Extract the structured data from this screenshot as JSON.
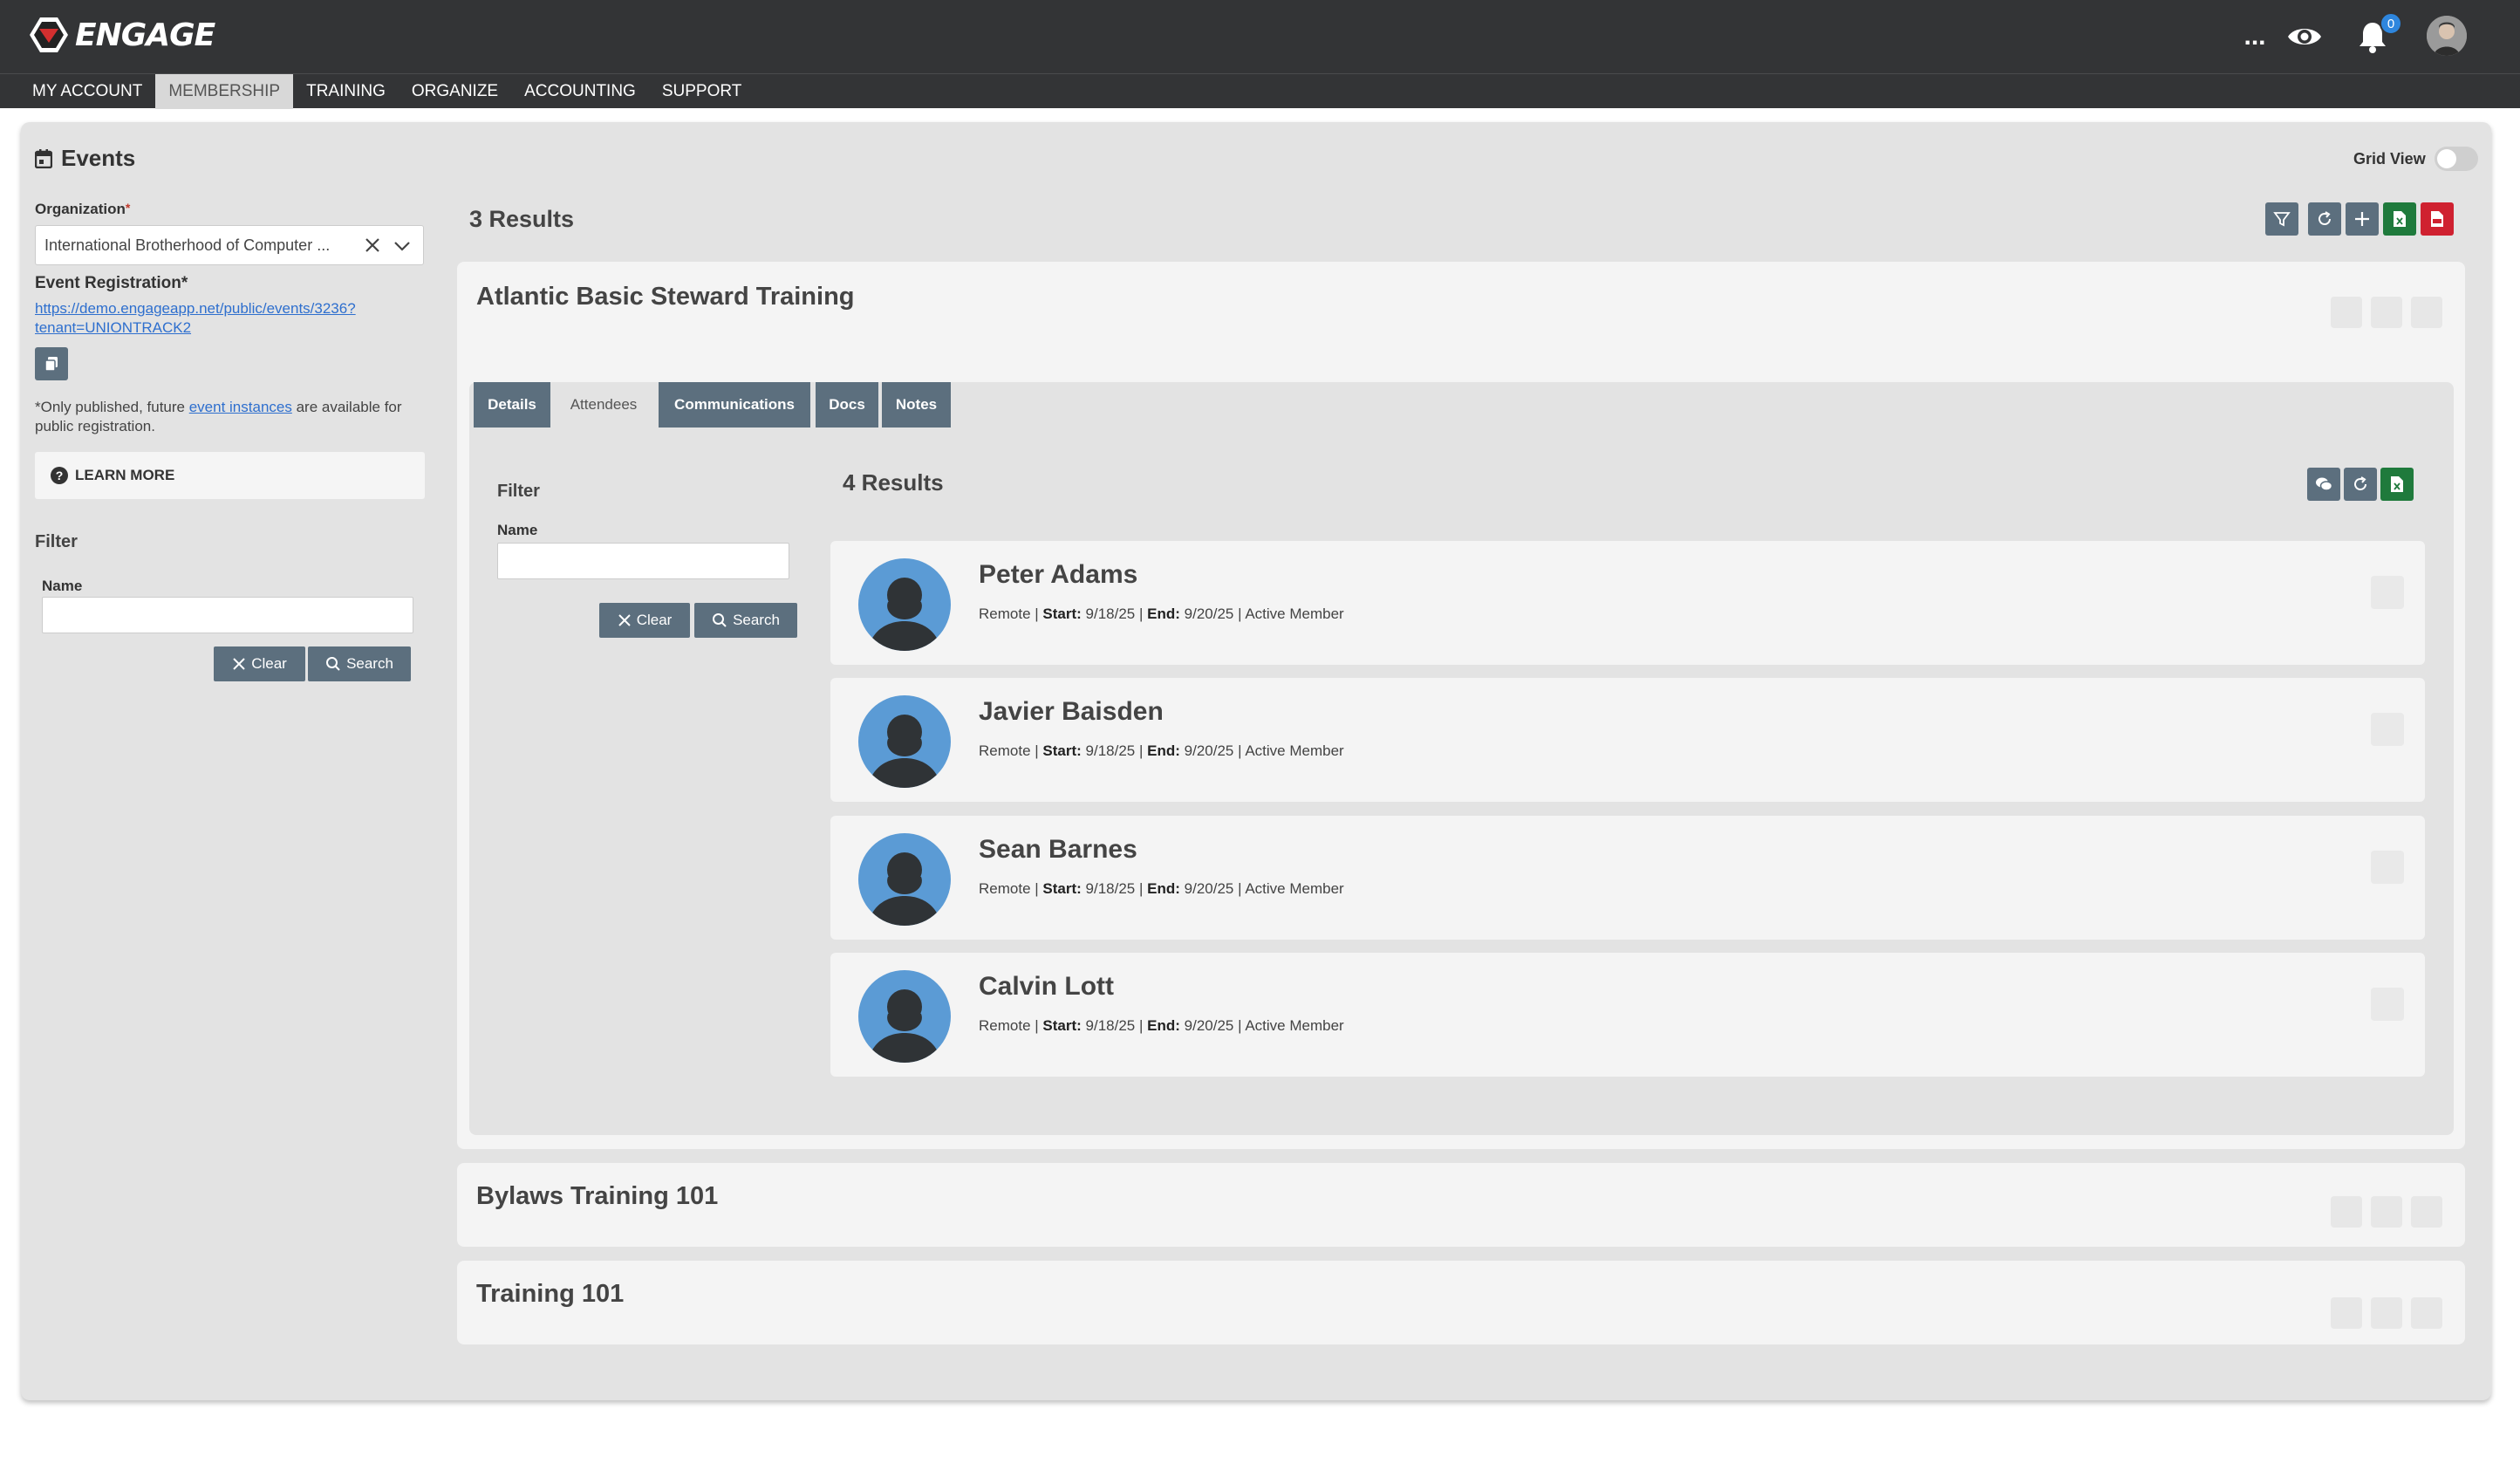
{
  "app": {
    "brand": "ENGAGE",
    "notification_count": "0",
    "more_label": "..."
  },
  "nav": [
    {
      "label": "MY ACCOUNT"
    },
    {
      "label": "MEMBERSHIP",
      "active": true
    },
    {
      "label": "TRAINING"
    },
    {
      "label": "ORGANIZE"
    },
    {
      "label": "ACCOUNTING"
    },
    {
      "label": "SUPPORT"
    }
  ],
  "sidebar": {
    "title": "Events",
    "org_label": "Organization",
    "org_required": "*",
    "org_value": "International Brotherhood of Computer ...",
    "reg_label": "Event Registration*",
    "reg_link_line1": "https://demo.engageapp.net/public/events/3236?",
    "reg_link_line2": "tenant=UNIONTRACK2",
    "note_prefix": "*Only published, future ",
    "note_link": "event instances",
    "note_suffix": " are available for public registration.",
    "learn_more": "LEARN MORE",
    "filter_title": "Filter",
    "name_label": "Name",
    "name_value": "",
    "clear_label": "Clear",
    "search_label": "Search"
  },
  "main": {
    "results": "3 Results",
    "grid_view_label": "Grid View",
    "grid_view_on": false
  },
  "events": [
    {
      "title": "Atlantic Basic Steward Training"
    },
    {
      "title": "Bylaws Training 101"
    },
    {
      "title": "Training 101"
    }
  ],
  "tabs": [
    {
      "label": "Details"
    },
    {
      "label": "Attendees",
      "active": true
    },
    {
      "label": "Communications"
    },
    {
      "label": "Docs"
    },
    {
      "label": "Notes"
    }
  ],
  "attendees_panel": {
    "filter_title": "Filter",
    "name_label": "Name",
    "name_value": "",
    "clear_label": "Clear",
    "search_label": "Search",
    "results": "4 Results"
  },
  "attendees": [
    {
      "name": "Peter Adams",
      "location": "Remote",
      "start_label": "Start:",
      "start": "9/18/25",
      "end_label": "End:",
      "end": "9/20/25",
      "status": "Active Member"
    },
    {
      "name": "Javier Baisden",
      "location": "Remote",
      "start_label": "Start:",
      "start": "9/18/25",
      "end_label": "End:",
      "end": "9/20/25",
      "status": "Active Member"
    },
    {
      "name": "Sean Barnes",
      "location": "Remote",
      "start_label": "Start:",
      "start": "9/18/25",
      "end_label": "End:",
      "end": "9/20/25",
      "status": "Active Member"
    },
    {
      "name": "Calvin Lott",
      "location": "Remote",
      "start_label": "Start:",
      "start": "9/18/25",
      "end_label": "End:",
      "end": "9/20/25",
      "status": "Active Member"
    }
  ],
  "colors": {
    "topbar": "#333436",
    "button": "#5c6f7e",
    "excel": "#1f7a3c",
    "pdf": "#cf2130",
    "avatar": "#5b9bd5",
    "link": "#2e6fce"
  }
}
